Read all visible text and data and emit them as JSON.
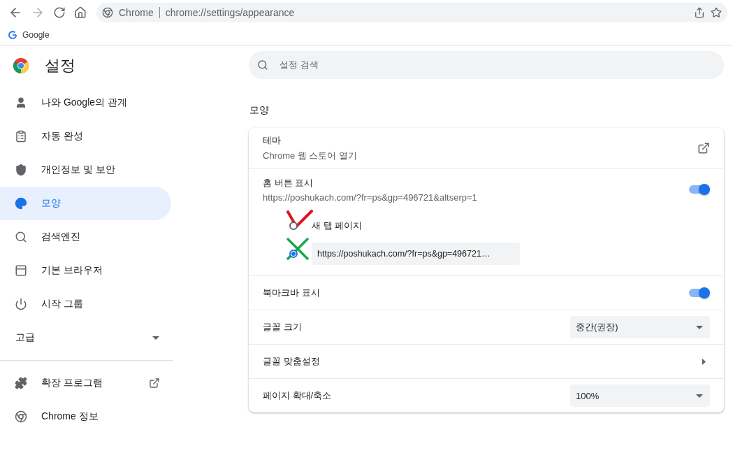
{
  "toolbar": {
    "site_label": "Chrome",
    "url": "chrome://settings/appearance"
  },
  "bookmarks": [
    {
      "label": "Google"
    }
  ],
  "header": {
    "title": "설정",
    "search_placeholder": "설정 검색"
  },
  "sidebar": {
    "items": [
      {
        "label": "나와 Google의 관계",
        "selected": false
      },
      {
        "label": "자동 완성",
        "selected": false
      },
      {
        "label": "개인정보 및 보안",
        "selected": false
      },
      {
        "label": "모양",
        "selected": true
      },
      {
        "label": "검색엔진",
        "selected": false
      },
      {
        "label": "기본 브라우저",
        "selected": false
      },
      {
        "label": "시작 그룹",
        "selected": false
      }
    ],
    "advanced": {
      "label": "고급",
      "expanded": false
    },
    "footer_items": [
      {
        "label": "확장 프로그램"
      },
      {
        "label": "Chrome 정보"
      }
    ]
  },
  "section": {
    "title": "모양",
    "rows": [
      {
        "kind": "link",
        "label": "테마",
        "sublabel": "Chrome 웹 스토어 열기"
      },
      {
        "kind": "toggle",
        "label": "홈 버튼 표시",
        "sublabel": "https://poshukach.com/?fr=ps&gp=496721&altserp=1",
        "on": true,
        "options": [
          {
            "kind": "label",
            "label": "새 탭 페이지",
            "selected": false
          },
          {
            "kind": "input",
            "value": "https://poshukach.com/?fr=ps&gp=496721…",
            "selected": true
          }
        ]
      },
      {
        "kind": "toggle",
        "label": "북마크바 표시",
        "on": true
      },
      {
        "kind": "select",
        "label": "글꼴 크기",
        "value": "중간(권장)"
      },
      {
        "kind": "arrow",
        "label": "글꼴 맞춤설정"
      },
      {
        "kind": "select",
        "label": "페이지 확대/축소",
        "value": "100%"
      }
    ]
  }
}
